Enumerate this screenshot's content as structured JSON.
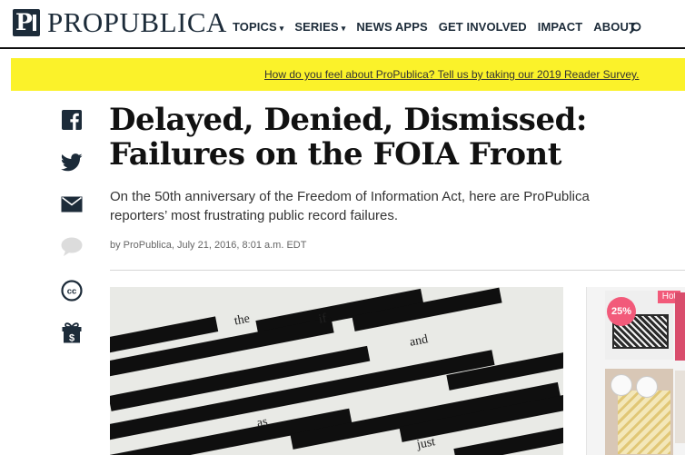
{
  "header": {
    "logo_text": "ProPublica",
    "logo_mark": "P",
    "nav": [
      {
        "label": "TOPICS",
        "has_dropdown": true
      },
      {
        "label": "SERIES",
        "has_dropdown": true
      },
      {
        "label": "NEWS APPS",
        "has_dropdown": false
      },
      {
        "label": "GET INVOLVED",
        "has_dropdown": false
      },
      {
        "label": "IMPACT",
        "has_dropdown": false
      },
      {
        "label": "ABOUT",
        "has_dropdown": false
      }
    ],
    "dropdown_glyph": "▾",
    "search_icon": "search-icon"
  },
  "banner": {
    "text": "How do you feel about ProPublica? Tell us by taking our 2019 Reader Survey.",
    "color": "#fbf22a"
  },
  "share_icons": [
    "facebook-icon",
    "twitter-icon",
    "email-icon",
    "comment-icon",
    "creative-commons-icon",
    "donate-gift-icon"
  ],
  "article": {
    "headline": "Delayed, Denied, Dismissed: Failures on the FOIA Front",
    "dek": "On the 50th anniversary of the Freedom of Information Act, here are ProPublica reporters’ most frustrating public record failures.",
    "byline": "by ProPublica, July 21, 2016, 8:01 a.m. EDT"
  },
  "lead_image": {
    "visible_words": [
      "the",
      "if",
      "and",
      "as",
      "just"
    ]
  },
  "ad": {
    "discount": "25%",
    "tag": "Hot",
    "accent": "#f25a7a"
  },
  "colors": {
    "brand": "#1c2b39",
    "text": "#111111"
  }
}
